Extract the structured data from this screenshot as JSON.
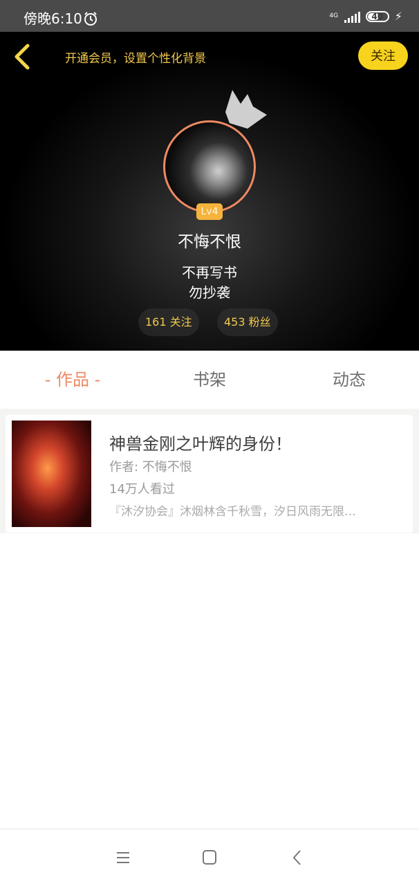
{
  "status_bar": {
    "time": "傍晚6:10",
    "network": "4G",
    "battery": "40"
  },
  "header": {
    "vip_prompt": "开通会员，设置个性化背景",
    "follow_button": "关注",
    "level": "Lv4",
    "username": "不悔不恨",
    "bio_line1": "不再写书",
    "bio_line2": "勿抄袭",
    "following": "161 关注",
    "fans": "453 粉丝"
  },
  "tabs": [
    {
      "label": "- 作品 -",
      "active": true
    },
    {
      "label": "书架",
      "active": false
    },
    {
      "label": "动态",
      "active": false
    }
  ],
  "works": [
    {
      "title": "神兽金刚之叶辉的身份！",
      "author": "作者: 不悔不恨",
      "views": "14万人看过",
      "description": "『沐汐协会』沐烟林含千秋雪，汐日风雨无限…"
    }
  ],
  "colors": {
    "accent": "#ee8a63",
    "gold": "#f2c94c",
    "follow_bg": "#f7d31e"
  },
  "icons": {
    "back": "back-arrow-icon",
    "crown": "crown-icon",
    "menu": "menu-icon",
    "home": "home-square-icon",
    "nav_back": "nav-back-icon"
  }
}
